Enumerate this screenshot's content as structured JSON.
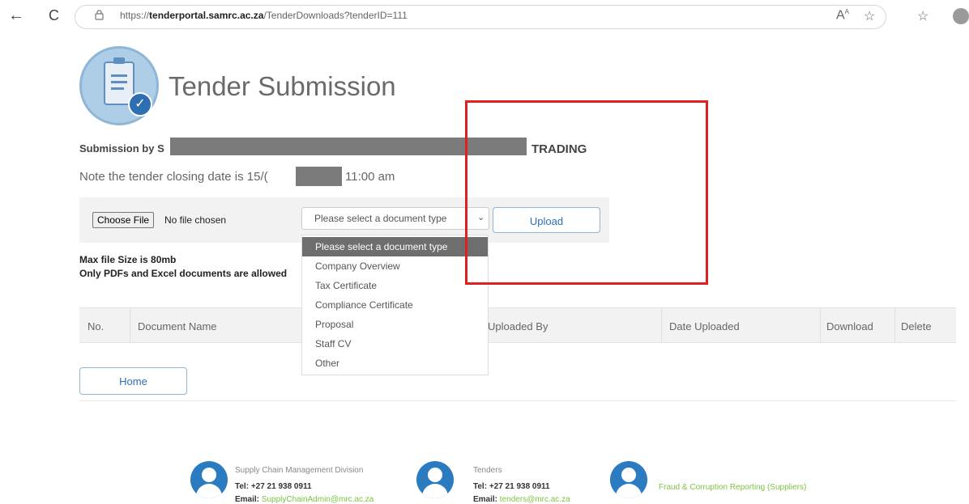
{
  "browser": {
    "back": "←",
    "reload": "C",
    "url_prefix": "https://",
    "url_domain": "tenderportal.samrc.ac.za",
    "url_path": "/TenderDownloads?tenderID=111"
  },
  "header": {
    "title": "Tender Submission"
  },
  "submission": {
    "by_label": "Submission by S",
    "trading": "TRADING",
    "closing_prefix": "Note the tender closing date is 15/(",
    "closing_time": "11:00 am"
  },
  "upload": {
    "choose_file": "Choose File",
    "no_file": "No file chosen",
    "select_value": "Please select a document type",
    "upload_label": "Upload"
  },
  "dropdown": {
    "options": [
      "Please select a document type",
      "Company Overview",
      "Tax Certificate",
      "Compliance Certificate",
      "Proposal",
      "Staff CV",
      "Other"
    ]
  },
  "notes": {
    "max_size": "Max file Size is 80mb",
    "allowed": "Only PDFs and Excel documents are allowed"
  },
  "table": {
    "headers": [
      "No.",
      "Document Name",
      "Uploaded By",
      "Date Uploaded",
      "Download",
      "Delete"
    ]
  },
  "home_label": "Home",
  "footer": {
    "scm_title": "Supply Chain Management Division",
    "scm_tel": "Tel: +27 21 938 0911",
    "scm_email_label": "Email: ",
    "scm_email": "SupplyChainAdmin@mrc.ac.za",
    "tenders_title": "Tenders",
    "tenders_tel": "Tel: +27 21 938 0911",
    "tenders_email_label": "Email: ",
    "tenders_email": "tenders@mrc.ac.za",
    "fraud": "Fraud & Corruption Reporting (Suppliers)"
  }
}
